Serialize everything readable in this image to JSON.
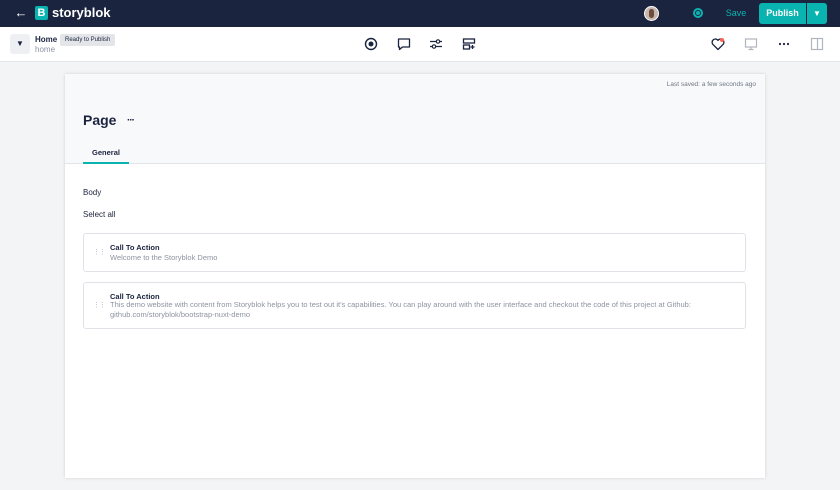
{
  "topbar": {
    "back_icon": "arrow-left-icon",
    "logo_letter": "B",
    "logo_text": "storyblok",
    "save_label": "Save",
    "publish_label": "Publish",
    "accent_color": "#09b3af",
    "bar_color": "#1b243f"
  },
  "subbar": {
    "title": "Home",
    "slug": "home",
    "status_badge": "Ready to Publish",
    "tools": [
      "target-icon",
      "comment-icon",
      "sliders-icon",
      "layout-icon"
    ],
    "right_icons": [
      "heart-icon",
      "monitor-icon",
      "more-icon",
      "panel-icon"
    ]
  },
  "editor": {
    "last_saved": "Last saved: a few seconds ago",
    "page_title": "Page",
    "more_label": "···",
    "tab_label": "General",
    "body_label": "Body",
    "select_all": "Select all",
    "blocks": [
      {
        "title": "Call To Action",
        "description": "Welcome to the Storyblok Demo"
      },
      {
        "title": "Call To Action",
        "description": "This demo website with content from Storyblok helps you to test out it's capabilities. You can play around with the user interface and checkout the code of this project at Github: github.com/storyblok/bootstrap-nuxt-demo"
      }
    ]
  }
}
